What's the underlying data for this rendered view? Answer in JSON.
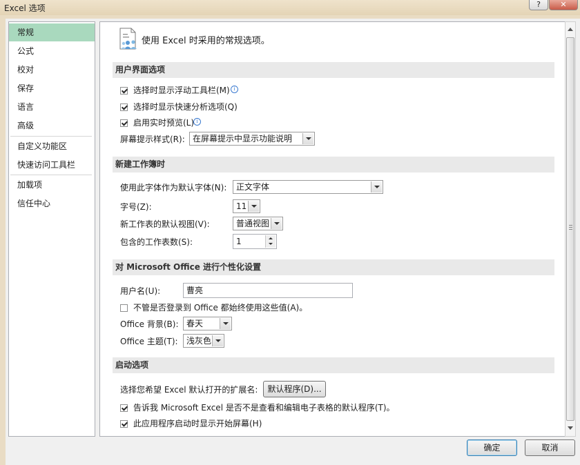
{
  "window": {
    "title": "Excel 选项",
    "help_label": "?",
    "close_label": "✕"
  },
  "nav": {
    "items": [
      {
        "label": "常规",
        "selected": true
      },
      {
        "label": "公式"
      },
      {
        "label": "校对"
      },
      {
        "label": "保存"
      },
      {
        "label": "语言"
      },
      {
        "label": "高级"
      },
      {
        "label": "自定义功能区"
      },
      {
        "label": "快速访问工具栏"
      },
      {
        "label": "加载项"
      },
      {
        "label": "信任中心"
      }
    ]
  },
  "header": {
    "text": "使用 Excel 时采用的常规选项。",
    "icon": "general-options-icon"
  },
  "ui_options": {
    "title": "用户界面选项",
    "mini_toolbar": {
      "label": "选择时显示浮动工具栏(M)",
      "checked": true
    },
    "quick_analysis": {
      "label": "选择时显示快速分析选项(Q)",
      "checked": true
    },
    "live_preview": {
      "label": "启用实时预览(L)",
      "checked": true
    },
    "screentip_label": "屏幕提示样式(R):",
    "screentip_value": "在屏幕提示中显示功能说明"
  },
  "new_workbook": {
    "title": "新建工作簿时",
    "font_label": "使用此字体作为默认字体(N):",
    "font_value": "正文字体",
    "size_label": "字号(Z):",
    "size_value": "11",
    "view_label": "新工作表的默认视图(V):",
    "view_value": "普通视图",
    "sheets_label": "包含的工作表数(S):",
    "sheets_value": "1"
  },
  "personalize": {
    "title": "对 Microsoft Office 进行个性化设置",
    "username_label": "用户名(U):",
    "username_value": "曹亮",
    "always_use": {
      "label": "不管是否登录到 Office 都始终使用这些值(A)。",
      "checked": false
    },
    "background_label": "Office 背景(B):",
    "background_value": "春天",
    "theme_label": "Office 主题(T):",
    "theme_value": "浅灰色"
  },
  "startup": {
    "title": "启动选项",
    "extensions_label": "选择您希望 Excel 默认打开的扩展名:",
    "default_programs_button": "默认程序(D)...",
    "tell_me": {
      "label": "告诉我 Microsoft Excel 是否不是查看和编辑电子表格的默认程序(T)。",
      "checked": true
    },
    "start_screen": {
      "label": "此应用程序启动时显示开始屏幕(H)",
      "checked": true
    }
  },
  "footer": {
    "ok_label": "确定",
    "cancel_label": "取消"
  },
  "colors": {
    "nav_selected": "#a9d9be",
    "section_bg": "#e9e9e9",
    "frame": "#e9dcc4"
  }
}
